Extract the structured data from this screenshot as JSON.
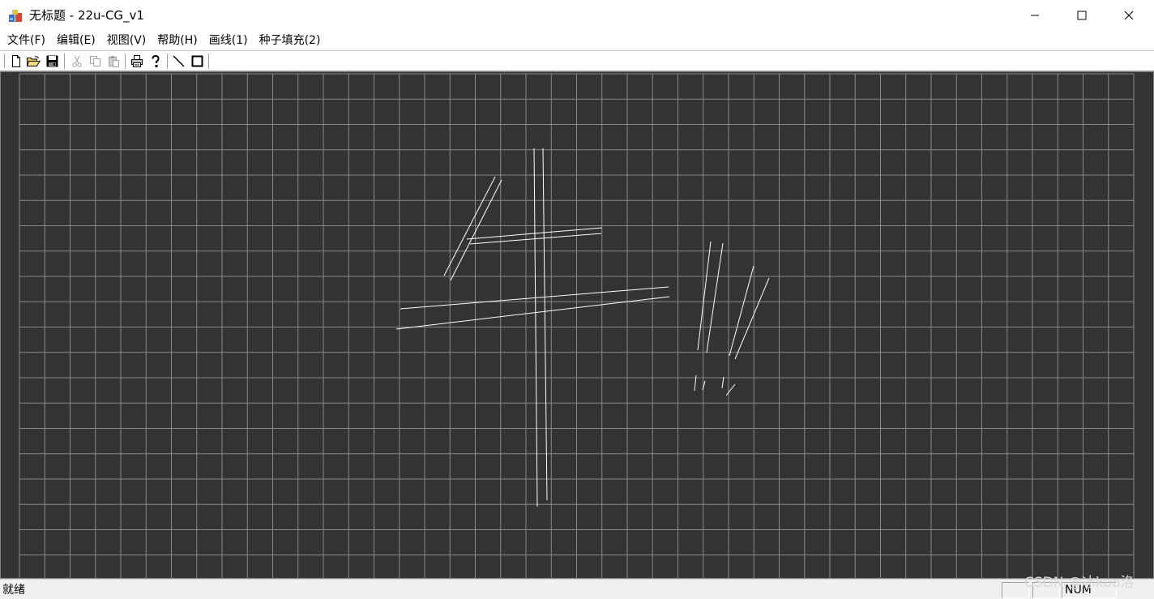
{
  "window": {
    "title": "无标题 - 22u-CG_v1",
    "app_icon": "mfc-app-icon",
    "controls": [
      "minimize-icon",
      "maximize-icon",
      "close-icon"
    ]
  },
  "menubar": {
    "items": [
      {
        "label": "文件(F)"
      },
      {
        "label": "编辑(E)"
      },
      {
        "label": "视图(V)"
      },
      {
        "label": "帮助(H)"
      },
      {
        "label": "画线(1)"
      },
      {
        "label": "种子填充(2)"
      }
    ]
  },
  "toolbar": {
    "buttons": [
      {
        "name": "new-file-icon",
        "enabled": true
      },
      {
        "name": "open-folder-icon",
        "enabled": true
      },
      {
        "name": "save-disk-icon",
        "enabled": true
      },
      {
        "name": "cut-scissors-icon",
        "enabled": false
      },
      {
        "name": "copy-icon",
        "enabled": false
      },
      {
        "name": "paste-icon",
        "enabled": false
      },
      {
        "name": "print-icon",
        "enabled": true
      },
      {
        "name": "help-question-icon",
        "enabled": true
      },
      {
        "name": "draw-line-icon",
        "enabled": true
      },
      {
        "name": "draw-rectangle-icon",
        "enabled": true
      }
    ]
  },
  "canvas": {
    "background": "#333333",
    "grid_color": "#8a8a8a",
    "stroke_color": "#ffffff",
    "grid_columns": 44,
    "grid_rows": 20
  },
  "statusbar": {
    "text": "就绪",
    "indicator": "NUM"
  },
  "watermark": "CSDN @冰kuo洛"
}
